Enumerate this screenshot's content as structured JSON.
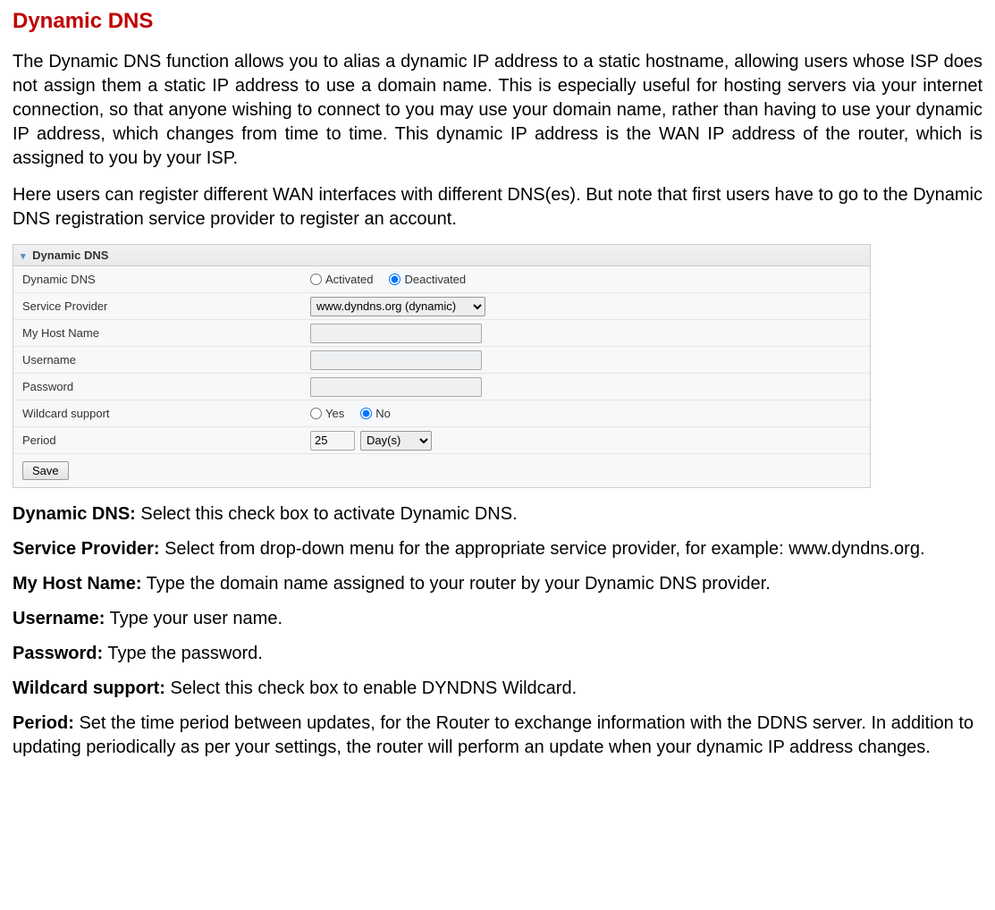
{
  "heading": "Dynamic DNS",
  "intro1": "The Dynamic DNS function allows you to alias a dynamic IP address to a static hostname, allowing users whose ISP does not assign them a static IP address to use a domain name. This is especially useful for hosting servers via your internet connection, so that anyone wishing to connect to you may use your domain name, rather than having to use your dynamic IP address, which changes from time to time. This dynamic IP address is the WAN IP address of the router, which is assigned to you by your ISP.",
  "intro2": "Here users can register different WAN interfaces with different DNS(es). But note that first users have to go to the Dynamic DNS registration service provider to register an account.",
  "panel": {
    "title": "Dynamic DNS",
    "rows": {
      "dynamic_dns": {
        "label": "Dynamic DNS",
        "opt_activated": "Activated",
        "opt_deactivated": "Deactivated",
        "selected": "Deactivated"
      },
      "service_provider": {
        "label": "Service Provider",
        "selected": "www.dyndns.org (dynamic)"
      },
      "hostname": {
        "label": "My Host Name",
        "value": ""
      },
      "username": {
        "label": "Username",
        "value": ""
      },
      "password": {
        "label": "Password",
        "value": ""
      },
      "wildcard": {
        "label": "Wildcard support",
        "opt_yes": "Yes",
        "opt_no": "No",
        "selected": "No"
      },
      "period": {
        "label": "Period",
        "value": "25",
        "unit": "Day(s)"
      }
    },
    "save": "Save"
  },
  "descriptions": {
    "dynamic_dns": {
      "label": "Dynamic DNS:",
      "text": " Select this check box to activate Dynamic DNS."
    },
    "service_provider": {
      "label": "Service Provider:",
      "text": " Select from drop-down menu for the appropriate service provider, for example: www.dyndns.org."
    },
    "hostname": {
      "label": "My Host Name:",
      "text": " Type the domain name assigned to your router by your Dynamic DNS provider."
    },
    "username": {
      "label": "Username:",
      "text": " Type your user name."
    },
    "password": {
      "label": "Password:",
      "text": " Type the password."
    },
    "wildcard": {
      "label": "Wildcard support:",
      "text": " Select this check box to enable DYNDNS Wildcard."
    },
    "period": {
      "label": "Period:",
      "text": " Set the time period between updates, for the Router to exchange information with the DDNS server. In addition to updating periodically as per your settings, the router will perform an update when your dynamic IP address changes."
    }
  }
}
